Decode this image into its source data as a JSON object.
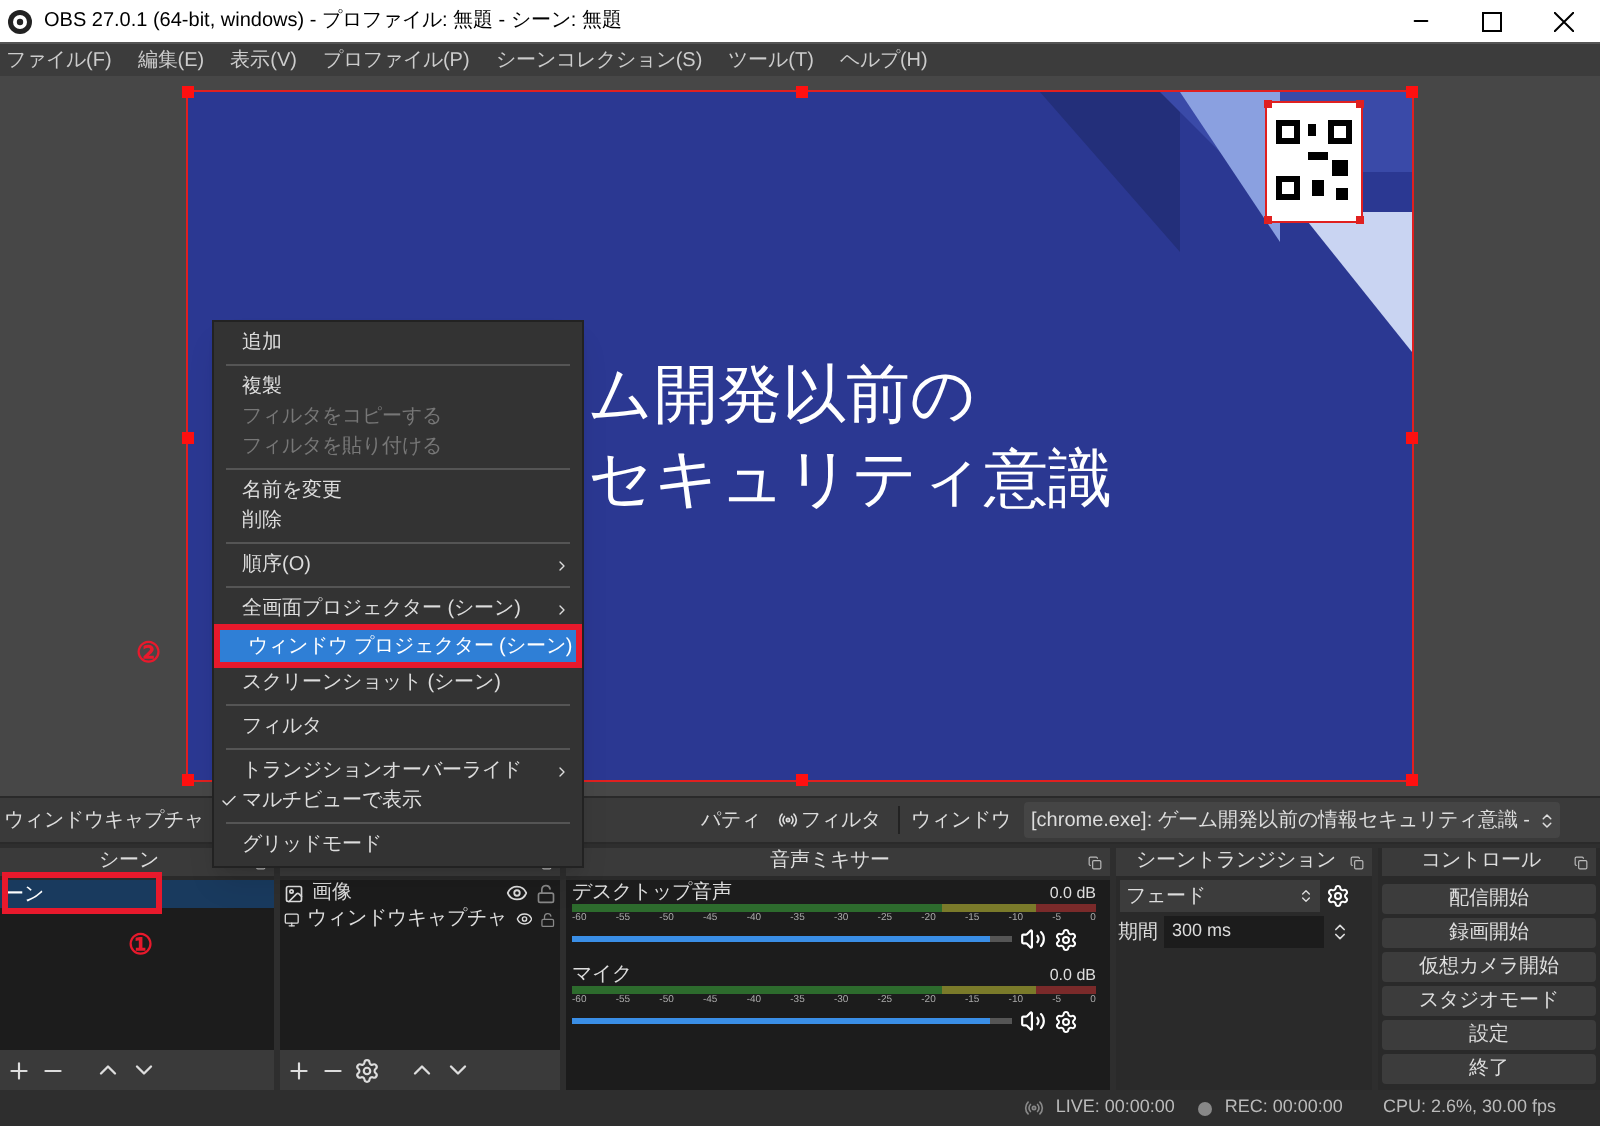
{
  "window": {
    "title": "OBS 27.0.1 (64-bit, windows) - プロファイル: 無題 - シーン: 無題"
  },
  "menubar": [
    "ファイル(F)",
    "編集(E)",
    "表示(V)",
    "プロファイル(P)",
    "シーンコレクション(S)",
    "ツール(T)",
    "ヘルプ(H)"
  ],
  "preview": {
    "slide_lines": [
      "ム開発以前の",
      "セキュリティ意識"
    ]
  },
  "context_menu": {
    "items": [
      {
        "kind": "item",
        "label": "追加",
        "disabled": false,
        "submenu": false,
        "checked": false,
        "selected": false
      },
      {
        "kind": "separator"
      },
      {
        "kind": "item",
        "label": "複製",
        "disabled": false,
        "submenu": false,
        "checked": false,
        "selected": false
      },
      {
        "kind": "item",
        "label": "フィルタをコピーする",
        "disabled": true,
        "submenu": false,
        "checked": false,
        "selected": false
      },
      {
        "kind": "item",
        "label": "フィルタを貼り付ける",
        "disabled": true,
        "submenu": false,
        "checked": false,
        "selected": false
      },
      {
        "kind": "separator"
      },
      {
        "kind": "item",
        "label": "名前を変更",
        "disabled": false,
        "submenu": false,
        "checked": false,
        "selected": false
      },
      {
        "kind": "item",
        "label": "削除",
        "disabled": false,
        "submenu": false,
        "checked": false,
        "selected": false
      },
      {
        "kind": "separator"
      },
      {
        "kind": "item",
        "label": "順序(O)",
        "disabled": false,
        "submenu": true,
        "checked": false,
        "selected": false
      },
      {
        "kind": "separator"
      },
      {
        "kind": "item",
        "label": "全画面プロジェクター (シーン)",
        "disabled": false,
        "submenu": true,
        "checked": false,
        "selected": false
      },
      {
        "kind": "item",
        "label": "ウィンドウ プロジェクター (シーン)",
        "disabled": false,
        "submenu": false,
        "checked": false,
        "selected": true
      },
      {
        "kind": "item",
        "label": "スクリーンショット (シーン)",
        "disabled": false,
        "submenu": false,
        "checked": false,
        "selected": false
      },
      {
        "kind": "separator"
      },
      {
        "kind": "item",
        "label": "フィルタ",
        "disabled": false,
        "submenu": false,
        "checked": false,
        "selected": false
      },
      {
        "kind": "separator"
      },
      {
        "kind": "item",
        "label": "トランジションオーバーライド",
        "disabled": false,
        "submenu": true,
        "checked": false,
        "selected": false
      },
      {
        "kind": "item",
        "label": "マルチビューで表示",
        "disabled": false,
        "submenu": false,
        "checked": true,
        "selected": false
      },
      {
        "kind": "separator"
      },
      {
        "kind": "item",
        "label": "グリッドモード",
        "disabled": false,
        "submenu": false,
        "checked": false,
        "selected": false
      }
    ]
  },
  "annotations": {
    "menu_marker": "②",
    "scene_marker": "①"
  },
  "source_toolbar": {
    "source_name": "ウィンドウキャプチャ",
    "properties": "パティ",
    "filters": "フィルタ",
    "window_label": "ウィンドウ",
    "window_value": "[chrome.exe]: ゲーム開発以前の情報セキュリティ意識 -"
  },
  "scenes": {
    "title": "シーン",
    "items": [
      {
        "label": "ーン",
        "selected": true
      }
    ]
  },
  "sources": {
    "items": [
      {
        "label": "画像"
      },
      {
        "label": "ウィンドウキャプチャ"
      }
    ]
  },
  "audio_mixer": {
    "title": "音声ミキサー",
    "channels": [
      {
        "name": "デスクトップ音声",
        "reading": "0.0 dB",
        "level": 0.95,
        "ticks": [
          "-60",
          "-55",
          "-50",
          "-45",
          "-40",
          "-35",
          "-30",
          "-25",
          "-20",
          "-15",
          "-10",
          "-5",
          "0"
        ]
      },
      {
        "name": "マイク",
        "reading": "0.0 dB",
        "level": 0.95,
        "ticks": [
          "-60",
          "-55",
          "-50",
          "-45",
          "-40",
          "-35",
          "-30",
          "-25",
          "-20",
          "-15",
          "-10",
          "-5",
          "0"
        ]
      }
    ]
  },
  "transitions": {
    "title": "シーントランジション",
    "transition": "フェード",
    "duration_label": "期間",
    "duration": "300 ms"
  },
  "controls": {
    "title": "コントロール",
    "buttons": [
      "配信開始",
      "録画開始",
      "仮想カメラ開始",
      "スタジオモード",
      "設定",
      "終了"
    ]
  },
  "status_bar": {
    "live": "LIVE: 00:00:00",
    "rec": "REC: 00:00:00",
    "cpu": "CPU: 2.6%, 30.00 fps"
  }
}
